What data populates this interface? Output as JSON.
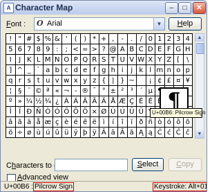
{
  "window": {
    "title": "Character Map",
    "minimize_glyph": "–",
    "maximize_glyph": "□",
    "close_glyph": "✕",
    "icon_name": "character-map-app-icon",
    "icon_glyph": "A"
  },
  "font": {
    "label_accel": "F",
    "label_rest": "ont :",
    "value": "Arial",
    "icon_name": "opentype-font-icon",
    "icon_glyph": "O",
    "dropdown_glyph": "▼"
  },
  "help_button": {
    "accel": "H",
    "rest": "elp"
  },
  "grid": {
    "selected_row": 7,
    "selected_col": 17,
    "rows": [
      [
        "!",
        "\"",
        "#",
        "$",
        "%",
        "&",
        "'",
        "(",
        ")",
        "*",
        "+",
        ",",
        "-",
        ".",
        "/",
        "0",
        "1",
        "2",
        "3",
        "4"
      ],
      [
        "5",
        "6",
        "7",
        "8",
        "9",
        ":",
        ";",
        "<",
        "=",
        ">",
        "?",
        "@",
        "A",
        "B",
        "C",
        "D",
        "E",
        "F",
        "G",
        "H"
      ],
      [
        "I",
        "J",
        "K",
        "L",
        "M",
        "N",
        "O",
        "P",
        "Q",
        "R",
        "S",
        "T",
        "U",
        "V",
        "W",
        "X",
        "Y",
        "Z",
        "[",
        "\\"
      ],
      [
        "]",
        "^",
        "_",
        "`",
        "a",
        "b",
        "c",
        "d",
        "e",
        "f",
        "g",
        "h",
        "i",
        "j",
        "k",
        "l",
        "m",
        "n",
        "o",
        "p"
      ],
      [
        "q",
        "r",
        "s",
        "t",
        "u",
        "v",
        "w",
        "x",
        "y",
        "z",
        "{",
        "|",
        "}",
        "~",
        " ",
        "¡",
        "¢",
        "£",
        "¤",
        "¥"
      ],
      [
        "¦",
        "§",
        "¨",
        "©",
        "ª",
        "«",
        "¬",
        "-",
        "®",
        "¯",
        "°",
        "±",
        "²",
        "³",
        "´",
        "µ",
        "¶",
        "·",
        "¸",
        "¹"
      ],
      [
        "º",
        "»",
        "¼",
        "½",
        "¾",
        "¿",
        "À",
        "Á",
        "Â",
        "Ã",
        "Ä",
        "Å",
        "Æ",
        "Ç",
        "È",
        "É",
        "Ê",
        "Ë",
        "Ì",
        "Í"
      ],
      [
        "Î",
        "Ï",
        "Ð",
        "Ñ",
        "Ò",
        "Ó",
        "Ô",
        "Õ",
        "Ö",
        "×",
        "Ø",
        "Ù",
        "Ú",
        "Û",
        "Ü",
        "Ý",
        "Þ",
        "ß",
        "à",
        "á"
      ],
      [
        "â",
        "ã",
        "ä",
        "å",
        "æ",
        "ç",
        "è",
        "é",
        "ê",
        "ë",
        "ì",
        "í",
        "î",
        "ï",
        "ð",
        "ñ",
        "ò",
        "ó",
        "ô",
        "õ"
      ],
      [
        "ö",
        "÷",
        "ø",
        "ù",
        "ú",
        "û",
        "ü",
        "ý",
        "þ",
        "ÿ",
        "Ā",
        "ā",
        "Ă",
        "ă",
        "Ą",
        "ą",
        "Ć",
        "ć",
        "Ĉ",
        "ĉ"
      ]
    ]
  },
  "scrollbar": {
    "up_glyph": "▲",
    "down_glyph": "▼"
  },
  "magnified": {
    "char": "¶"
  },
  "tooltip": {
    "text": "U+00B6: Pilcrow Sign"
  },
  "copy": {
    "label_pre": "C",
    "label_accel": "h",
    "label_rest": "aracters to copy :",
    "value": ""
  },
  "select_button": {
    "accel": "S",
    "rest": "elect"
  },
  "copy_button": {
    "accel": "C",
    "rest": "opy"
  },
  "advanced": {
    "label_accel": "A",
    "label_rest": "dvanced view",
    "checked": false
  },
  "status": {
    "code": "U+00B6 :",
    "name": "Pilcrow Sign",
    "keystroke": "Keystroke: Alt+0182"
  },
  "colors": {
    "window_face": "#ece9d8",
    "title_gradient_top": "#dde6f6",
    "tooltip_bg": "#ffffe1",
    "highlight_border": "#e00000"
  }
}
